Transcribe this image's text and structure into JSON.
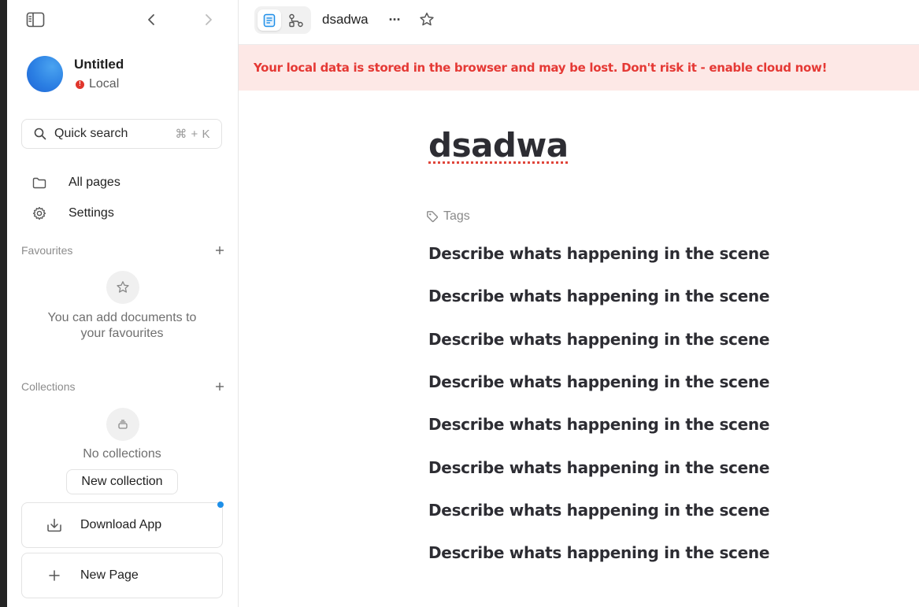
{
  "sidebar": {
    "workspace": {
      "name": "Untitled",
      "status": "Local",
      "status_badge": "!"
    },
    "search": {
      "label": "Quick search",
      "shortcut": "⌘ + K"
    },
    "nav": [
      {
        "label": "All pages",
        "icon": "folder-icon"
      },
      {
        "label": "Settings",
        "icon": "gear-icon"
      }
    ],
    "favourites": {
      "title": "Favourites",
      "empty_text_line1": "You can add documents to",
      "empty_text_line2": "your favourites"
    },
    "collections": {
      "title": "Collections",
      "empty_text": "No collections",
      "new_button": "New collection"
    },
    "download_app": "Download App",
    "new_page": "New Page"
  },
  "header": {
    "doc_title": "dsadwa",
    "more_glyph": "···"
  },
  "banner": {
    "text": "Your local data is stored in the browser and may be lost. Don't risk it - enable cloud now!",
    "color": "#e53935",
    "background": "#fde8e6"
  },
  "document": {
    "title": "dsadwa",
    "tags_label": "Tags",
    "paragraphs": [
      "Describe whats happening in the scene",
      "Describe whats happening in the scene",
      "Describe whats happening in the scene",
      "Describe whats happening in the scene",
      "Describe whats happening in the scene",
      "Describe whats happening in the scene",
      "Describe whats happening in the scene",
      "Describe whats happening in the scene"
    ]
  },
  "colors": {
    "accent_blue": "#1e8fe8",
    "warning_red": "#e0362c"
  }
}
